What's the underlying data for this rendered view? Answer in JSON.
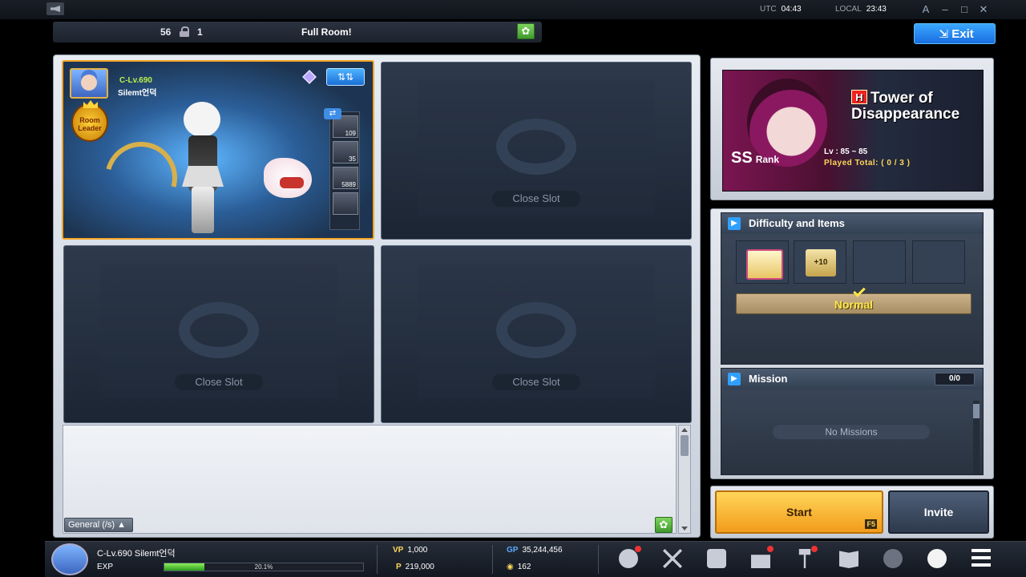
{
  "system": {
    "utc_label": "UTC",
    "utc_time": "04:43",
    "local_label": "LOCAL",
    "local_time": "23:43",
    "win_font": "A",
    "win_min": "–",
    "win_max": "□",
    "win_close": "✕"
  },
  "room": {
    "number": "56",
    "capacity": "1",
    "title": "Full Room!",
    "settings_icon": "gear-icon"
  },
  "exit_label": "Exit",
  "player_slot": {
    "level": "C-Lv.690",
    "name": "Silemt언덕",
    "leader_label": "Room Leader",
    "equip_counts": [
      "109",
      "35",
      "5889"
    ]
  },
  "closed_slots": [
    {
      "label": "Close Slot"
    },
    {
      "label": "Close Slot"
    },
    {
      "label": "Close Slot"
    }
  ],
  "chat": {
    "channel": "General (/s)"
  },
  "dungeon": {
    "name_line1": "Tower of",
    "name_line2": "Disappearance",
    "hard_mark": "H",
    "rank": "SS",
    "rank_label": "Rank",
    "level_range": "Lv : 85 ~ 85",
    "played_total": "Played Total: ( 0 / 3 )"
  },
  "difficulty": {
    "header": "Difficulty and Items",
    "item_b_text": "+10",
    "selected": "Normal"
  },
  "mission": {
    "header": "Mission",
    "count": "0/0",
    "empty_text": "No Missions"
  },
  "actions": {
    "start": "Start",
    "start_key": "F5",
    "invite": "Invite"
  },
  "bottom": {
    "player": "C-Lv.690 Silemt언덕",
    "exp_label": "EXP",
    "exp_percent_text": "20.1%",
    "exp_fraction": 0.201,
    "vp_tag": "VP",
    "vp": "1,000",
    "gp_tag": "GP",
    "gp": "35,244,456",
    "p_tag": "P",
    "points": "219,000",
    "coin": "162"
  },
  "colors": {
    "accent_blue": "#2a8cf0",
    "leader_orange": "#f7a526",
    "normal_yellow": "#ffe74a"
  }
}
